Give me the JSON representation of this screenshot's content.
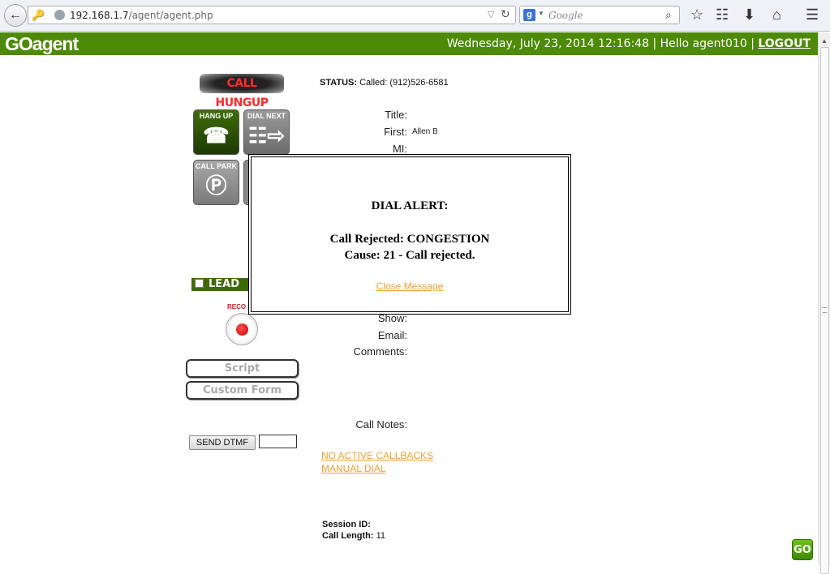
{
  "browser": {
    "url_host": "192.168.1.7",
    "url_path": "/agent/agent.php",
    "search_placeholder": "Google"
  },
  "header": {
    "logo": "GOagent",
    "datetime": "Wednesday, July 23, 2014 12:16:48",
    "greeting": "Hello agent010",
    "separator": "|",
    "logout_label": "LOGOUT"
  },
  "call": {
    "status_badge": "CALL HUNGUP",
    "status_label": "STATUS:",
    "status_value": "Called: (912)526-6581"
  },
  "buttons": {
    "hang_up": "HANG UP",
    "dial_next": "DIAL NEXT",
    "call_park": "CALL PARK",
    "lead_preview": "LEAD P",
    "record_label": "RECO",
    "script": "Script",
    "custom_form": "Custom Form",
    "send_dtmf": "SEND DTMF"
  },
  "form": {
    "title_label": "Title:",
    "first_label": "First:",
    "first_value": "Allen B",
    "mi_label": "MI:",
    "show_label": "Show:",
    "email_label": "Email:",
    "comments_label": "Comments:",
    "call_notes_label": "Call Notes:"
  },
  "links": {
    "callbacks": "NO ACTIVE CALLBACKS",
    "manual_dial": "MANUAL DIAL"
  },
  "session": {
    "session_id_label": "Session ID:",
    "session_id_value": "",
    "call_length_label": "Call Length:",
    "call_length_value": "11"
  },
  "modal": {
    "title": "DIAL ALERT:",
    "line1": "Call Rejected: CONGESTION",
    "line2": "Cause: 21 - Call rejected.",
    "close_label": "Close Message"
  },
  "badge": {
    "go": "GO"
  },
  "colors": {
    "header_green": "#4c8a08",
    "link_orange": "#f0a030",
    "status_red": "#ff2a2a"
  }
}
